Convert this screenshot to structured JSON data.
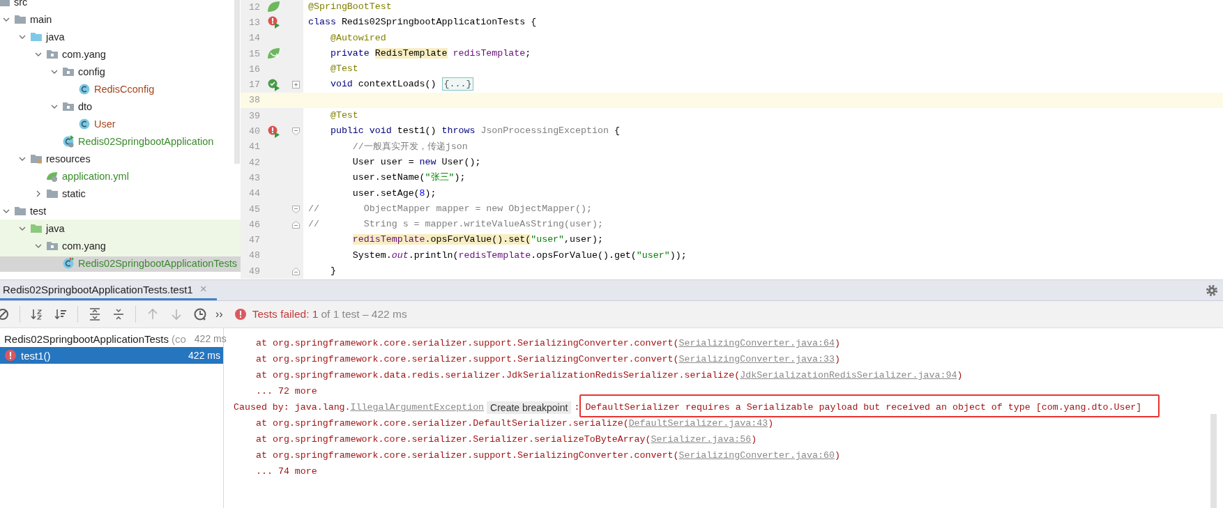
{
  "project_tree": {
    "nodes": [
      {
        "label": "src",
        "kind": "folder",
        "selected": false,
        "test_scope": false,
        "children": [
          {
            "label": "main",
            "kind": "folder",
            "expanded": true,
            "selected": false,
            "test_scope": false,
            "children": [
              {
                "label": "java",
                "kind": "source-folder",
                "expanded": true,
                "selected": false,
                "test_scope": false,
                "children": [
                  {
                    "label": "com.yang",
                    "kind": "package",
                    "expanded": true,
                    "selected": false,
                    "test_scope": false,
                    "children": [
                      {
                        "label": "config",
                        "kind": "package",
                        "expanded": true,
                        "selected": false,
                        "test_scope": false,
                        "children": [
                          {
                            "label": "RedisCconfig",
                            "kind": "class",
                            "color": "#a4451b",
                            "selected": false,
                            "test_scope": false
                          }
                        ]
                      },
                      {
                        "label": "dto",
                        "kind": "package",
                        "expanded": true,
                        "selected": false,
                        "test_scope": false,
                        "children": [
                          {
                            "label": "User",
                            "kind": "class",
                            "color": "#a4451b",
                            "selected": false,
                            "test_scope": false
                          }
                        ]
                      },
                      {
                        "label": "Redis02SpringbootApplication",
                        "kind": "spring-app",
                        "color": "#3a8a2c",
                        "selected": false,
                        "test_scope": false
                      }
                    ]
                  }
                ]
              },
              {
                "label": "resources",
                "kind": "resources-folder",
                "expanded": true,
                "selected": false,
                "test_scope": false,
                "children": [
                  {
                    "label": "application.yml",
                    "kind": "yml",
                    "color": "#3a8a2c",
                    "selected": false,
                    "test_scope": false
                  },
                  {
                    "label": "static",
                    "kind": "folder",
                    "expanded": false,
                    "selected": false,
                    "test_scope": false
                  }
                ]
              }
            ]
          },
          {
            "label": "test",
            "kind": "folder",
            "expanded": true,
            "selected": false,
            "test_scope": false,
            "children": [
              {
                "label": "java",
                "kind": "test-folder",
                "expanded": true,
                "selected": false,
                "test_scope": true,
                "children": [
                  {
                    "label": "com.yang",
                    "kind": "package",
                    "expanded": true,
                    "selected": false,
                    "test_scope": true,
                    "children": [
                      {
                        "label": "Redis02SpringbootApplicationTests",
                        "kind": "test-class",
                        "color": "#3a8a2c",
                        "selected": true,
                        "test_scope": true
                      }
                    ]
                  }
                ]
              }
            ]
          }
        ]
      }
    ]
  },
  "editor": {
    "lines": [
      {
        "number": "12",
        "gutter": {
          "kind": "spring"
        },
        "current": false,
        "segments": [
          {
            "text": "@SpringBootTest",
            "kind": "annotation"
          }
        ]
      },
      {
        "number": "13",
        "gutter": {
          "kind": "run-failed"
        },
        "current": false,
        "segments": [
          {
            "text": "class",
            "kind": "keyword"
          },
          {
            "text": " Redis02SpringbootApplicationTests {",
            "kind": "plain"
          }
        ]
      },
      {
        "number": "14",
        "current": false,
        "segments": [
          {
            "text": "    @Autowired",
            "kind": "annotation"
          }
        ]
      },
      {
        "number": "15",
        "gutter": {
          "kind": "bean"
        },
        "current": false,
        "segments": [
          {
            "text": "    private ",
            "kind": "keyword"
          },
          {
            "text": "RedisTemplate",
            "kind": "plain",
            "highlighted": true
          },
          {
            "text": " redisTemplate",
            "kind": "field"
          },
          {
            "text": ";",
            "kind": "plain"
          }
        ]
      },
      {
        "number": "16",
        "current": false,
        "segments": [
          {
            "text": "    @Test",
            "kind": "annotation"
          }
        ]
      },
      {
        "number": "17",
        "gutter": {
          "kind": "run-passed"
        },
        "fold": {
          "kind": "plus"
        },
        "current": false,
        "segments": [
          {
            "text": "    void",
            "kind": "keyword"
          },
          {
            "text": " contextLoads() ",
            "kind": "plain"
          },
          {
            "text": "{...}",
            "kind": "folded"
          }
        ]
      },
      {
        "number": "38",
        "current": true
      },
      {
        "number": "39",
        "current": false,
        "segments": [
          {
            "text": "    @Test",
            "kind": "annotation"
          }
        ]
      },
      {
        "number": "40",
        "gutter": {
          "kind": "run-failed"
        },
        "fold": {
          "kind": "open"
        },
        "current": false,
        "segments": [
          {
            "text": "    public void",
            "kind": "keyword"
          },
          {
            "text": " test1() ",
            "kind": "plain"
          },
          {
            "text": "throws",
            "kind": "keyword"
          },
          {
            "text": " JsonProcessingException",
            "kind": "unused"
          },
          {
            "text": " {",
            "kind": "plain"
          }
        ]
      },
      {
        "number": "41",
        "current": false,
        "segments": [
          {
            "text": "        //一般真实开发，传递json",
            "kind": "comment"
          }
        ]
      },
      {
        "number": "42",
        "current": false,
        "segments": [
          {
            "text": "        User user = ",
            "kind": "plain"
          },
          {
            "text": "new",
            "kind": "keyword"
          },
          {
            "text": " User();",
            "kind": "plain"
          }
        ]
      },
      {
        "number": "43",
        "current": false,
        "segments": [
          {
            "text": "        user.setName(",
            "kind": "plain"
          },
          {
            "text": "\"张三\"",
            "kind": "string"
          },
          {
            "text": ");",
            "kind": "plain"
          }
        ]
      },
      {
        "number": "44",
        "current": false,
        "segments": [
          {
            "text": "        user.setAge(",
            "kind": "plain"
          },
          {
            "text": "8",
            "kind": "number"
          },
          {
            "text": ");",
            "kind": "plain"
          }
        ]
      },
      {
        "number": "45",
        "fold": {
          "kind": "open"
        },
        "current": false,
        "segments": [
          {
            "text": "//        ObjectMapper mapper = new ObjectMapper();",
            "kind": "comment"
          }
        ]
      },
      {
        "number": "46",
        "fold": {
          "kind": "close"
        },
        "current": false,
        "segments": [
          {
            "text": "//        String s = mapper.writeValueAsString(user);",
            "kind": "comment"
          }
        ]
      },
      {
        "number": "47",
        "current": false,
        "segments": [
          {
            "text": "        redisTemplate",
            "kind": "field",
            "highlighted": true
          },
          {
            "text": ".opsForValue().set(",
            "kind": "plain",
            "highlighted": true
          },
          {
            "text": "\"user\"",
            "kind": "string"
          },
          {
            "text": ",user);",
            "kind": "plain"
          }
        ]
      },
      {
        "number": "48",
        "current": false,
        "segments": [
          {
            "text": "        System.",
            "kind": "plain"
          },
          {
            "text": "out",
            "kind": "static"
          },
          {
            "text": ".println(",
            "kind": "plain"
          },
          {
            "text": "redisTemplate",
            "kind": "field"
          },
          {
            "text": ".opsForValue().get(",
            "kind": "plain"
          },
          {
            "text": "\"user\"",
            "kind": "string"
          },
          {
            "text": "));",
            "kind": "plain"
          }
        ]
      },
      {
        "number": "49",
        "fold": {
          "kind": "close"
        },
        "current": false,
        "segments": [
          {
            "text": "    }",
            "kind": "plain"
          }
        ]
      }
    ]
  },
  "run_panel": {
    "tab": {
      "label": "Redis02SpringbootApplicationTests.test1",
      "close": "×",
      "selected": true
    },
    "toolbar": {
      "buttons": [
        {
          "kind": "stop",
          "disabled": false
        },
        {
          "kind": "sort-alpha",
          "disabled": false
        },
        {
          "kind": "sort-duration",
          "disabled": false
        },
        {
          "kind": "expand-all",
          "disabled": false
        },
        {
          "kind": "collapse-all",
          "disabled": false
        },
        {
          "kind": "up",
          "disabled": true
        },
        {
          "kind": "down",
          "disabled": true
        },
        {
          "kind": "history",
          "disabled": false
        }
      ],
      "overflow": "››"
    },
    "status": {
      "label": "Tests failed: 1",
      "detail": "of 1 test – 422 ms",
      "failed": true
    },
    "results": [
      {
        "label": "Redis02SpringbootApplicationTests",
        "note": "(co",
        "time": "422 ms",
        "selected": false
      },
      {
        "label": "test1()",
        "time": "422 ms",
        "failed": true,
        "selected": true
      }
    ],
    "console": {
      "lines": [
        {
          "kind": "frame",
          "text": "at org.springframework.core.serializer.support.SerializingConverter.convert(",
          "link": "SerializingConverter.java:64",
          "tail": ")"
        },
        {
          "kind": "frame",
          "text": "at org.springframework.core.serializer.support.SerializingConverter.convert(",
          "link": "SerializingConverter.java:33",
          "tail": ")"
        },
        {
          "kind": "frame",
          "text": "at org.springframework.data.redis.serializer.JdkSerializationRedisSerializer.serialize(",
          "link": "JdkSerializationRedisSerializer.java:94",
          "tail": ")"
        },
        {
          "kind": "more",
          "text": "... 72 more"
        },
        {
          "kind": "caused",
          "text": "Caused by: java.lang.",
          "link": "IllegalArgumentException",
          "chip": "Create breakpoint",
          "separator": ":",
          "message": "DefaultSerializer requires a Serializable payload but received an object of type [com.yang.dto.User]",
          "highlighted": true
        },
        {
          "kind": "frame",
          "text": "at org.springframework.core.serializer.DefaultSerializer.serialize(",
          "link": "DefaultSerializer.java:43",
          "tail": ")"
        },
        {
          "kind": "frame",
          "text": "at org.springframework.core.serializer.Serializer.serializeToByteArray(",
          "link": "Serializer.java:56",
          "tail": ")"
        },
        {
          "kind": "frame",
          "text": "at org.springframework.core.serializer.support.SerializingConverter.convert(",
          "link": "SerializingConverter.java:60",
          "tail": ")"
        },
        {
          "kind": "more",
          "text": "... 74 more"
        }
      ]
    }
  }
}
